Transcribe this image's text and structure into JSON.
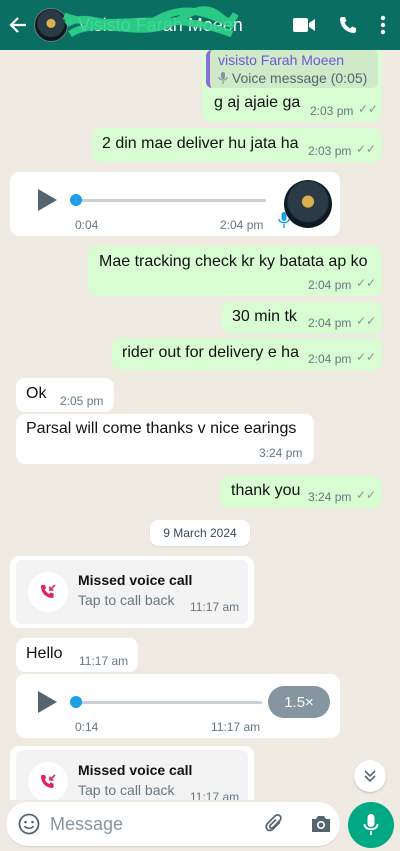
{
  "header": {
    "contact_name": "Visisto Farah Moeen"
  },
  "messages": {
    "m1": {
      "reply_name": "visisto Farah Moeen",
      "reply_sub": "Voice message (0:05)",
      "text": "g aj ajaie ga",
      "time": "2:03 pm"
    },
    "m2": {
      "text": "2 din mae deliver hu jata ha",
      "time": "2:03 pm"
    },
    "v1": {
      "duration": "0:04",
      "time": "2:04 pm",
      "progress": 0.0
    },
    "m3": {
      "text": "Mae tracking check kr ky batata ap ko",
      "time": "2:04 pm"
    },
    "m4": {
      "text": "30 min tk",
      "time": "2:04 pm"
    },
    "m5": {
      "text": "rider out for delivery e ha",
      "time": "2:04 pm"
    },
    "m6": {
      "text": "Ok",
      "time": "2:05 pm"
    },
    "m7": {
      "text": "Parsal will come thanks v nice earings",
      "time": "3:24 pm"
    },
    "m8": {
      "text": "thank you",
      "time": "3:24 pm"
    },
    "date": "9 March 2024",
    "c1": {
      "title": "Missed voice call",
      "sub": "Tap to call back",
      "time": "11:17 am"
    },
    "m9": {
      "text": "Hello",
      "time": "11:17 am"
    },
    "v2": {
      "duration": "0:14",
      "time": "11:17 am",
      "speed": "1.5×",
      "progress": 0.0
    },
    "c2": {
      "title": "Missed voice call",
      "sub": "Tap to call back",
      "time": "11:17 am"
    }
  },
  "footer": {
    "placeholder": "Message"
  },
  "icons": {
    "back": "arrow-left-icon",
    "video": "video-camera-icon",
    "call": "phone-icon",
    "menu": "more-vertical-icon",
    "emoji": "emoji-icon",
    "attach": "paperclip-icon",
    "camera": "camera-icon",
    "mic": "microphone-icon",
    "missed_call": "missed-call-icon",
    "play": "play-icon",
    "scroll": "chevron-double-down-icon"
  },
  "colors": {
    "header": "#0b6e62",
    "outgoing": "#d9fdd3",
    "incoming": "#ffffff",
    "accent": "#00a884",
    "missed": "#e0245e"
  }
}
